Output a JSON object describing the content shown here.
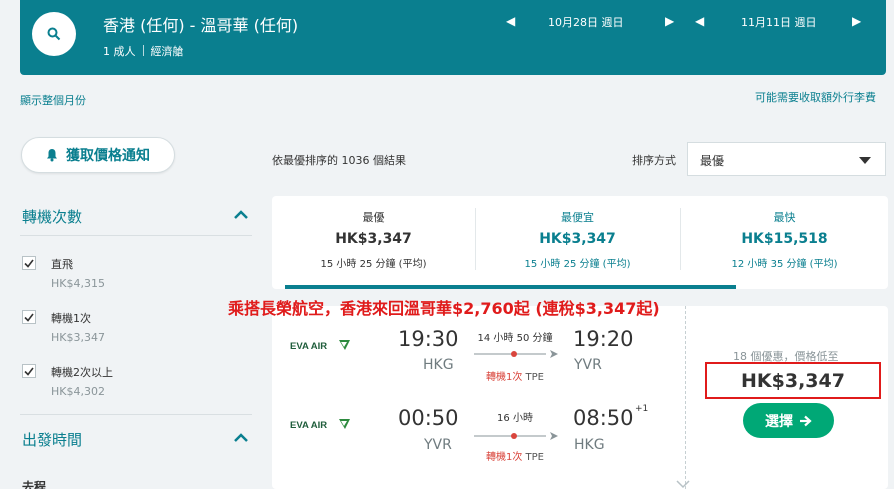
{
  "header": {
    "route": "香港 (任何) - 溫哥華 (任何)",
    "passengers": "1 成人",
    "cabin": "經濟艙",
    "depart_date": "10月28日 週日",
    "return_date": "11月11日 週日"
  },
  "links": {
    "show_month": "顯示整個月份",
    "baggage_fees": "可能需要收取額外行李費"
  },
  "price_alert": {
    "label": "獲取價格通知"
  },
  "filters": {
    "stops_title": "轉機次數",
    "stops": [
      {
        "label": "直飛",
        "price": "HK$4,315",
        "checked": true
      },
      {
        "label": "轉機1次",
        "price": "HK$3,347",
        "checked": true
      },
      {
        "label": "轉機2次以上",
        "price": "HK$4,302",
        "checked": true
      }
    ],
    "departure_title": "出發時間",
    "outbound_label": "去程"
  },
  "results": {
    "summary": "依最優排序的 1036 個結果",
    "sort_label": "排序方式",
    "sort_value": "最優"
  },
  "sort_tabs": [
    {
      "label": "最優",
      "price": "HK$3,347",
      "duration": "15 小時 25 分鐘 (平均)"
    },
    {
      "label": "最便宜",
      "price": "HK$3,347",
      "duration": "15 小時 25 分鐘 (平均)"
    },
    {
      "label": "最快",
      "price": "HK$15,518",
      "duration": "12 小時 35 分鐘 (平均)"
    }
  ],
  "promo_text": "乘搭長榮航空，香港來回溫哥華$2,760起 (連稅$3,347起)",
  "card": {
    "airline": "EVA AIR",
    "outbound": {
      "dep_time": "19:30",
      "dep_airport": "HKG",
      "duration": "14 小時 50 分鐘",
      "stops": "轉機1次",
      "via": "TPE",
      "arr_time": "19:20",
      "arr_airport": "YVR"
    },
    "inbound": {
      "dep_time": "00:50",
      "dep_airport": "YVR",
      "duration": "16 小時",
      "stops": "轉機1次",
      "via": "TPE",
      "arr_time": "08:50",
      "arr_day_offset": "+1",
      "arr_airport": "HKG"
    },
    "offers_text": "18 個優惠，價格低至",
    "price": "HK$3,347",
    "select_label": "選擇"
  },
  "colors": {
    "teal": "#0a7f8f",
    "green": "#00a876",
    "red": "#e01b1b"
  }
}
